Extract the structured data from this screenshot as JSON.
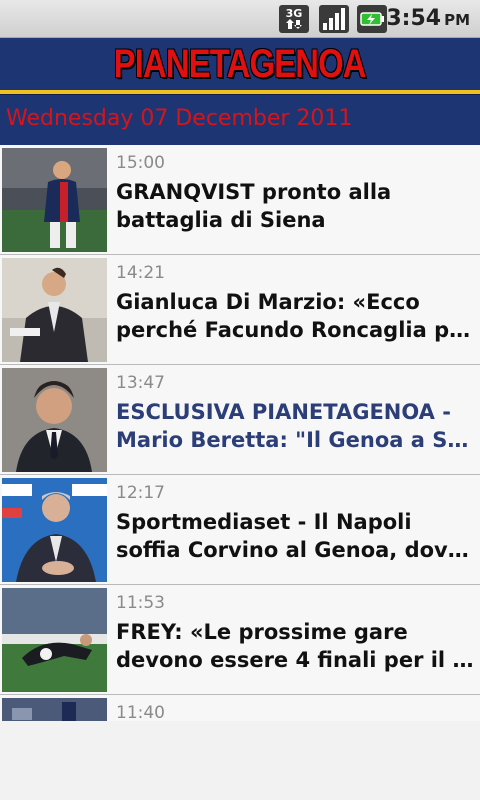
{
  "status_bar": {
    "network": "3G",
    "time": "3:54",
    "ampm": "PM"
  },
  "app": {
    "logo": "PIANETAGENOA",
    "date": "Wednesday 07 December 2011",
    "colors": {
      "header_bg": "#1e3574",
      "logo_red": "#e01010",
      "accent_gold": "#f0c020",
      "date_red": "#d7141a",
      "read_title": "#2c3e78"
    }
  },
  "news": [
    {
      "time": "15:00",
      "line1": "GRANQVIST pronto alla",
      "line2": "battaglia di Siena",
      "read": false
    },
    {
      "time": "14:21",
      "line1": "Gianluca Di Marzio: «Ecco",
      "line2": "perché Facundo Roncaglia po…",
      "read": false
    },
    {
      "time": "13:47",
      "line1": "ESCLUSIVA PIANETAGENOA -",
      "line2": "Mario Beretta: \"Il Genoa a Si…",
      "read": true
    },
    {
      "time": "12:17",
      "line1": "Sportmediaset - Il Napoli",
      "line2": "soffia Corvino al Genoa, dove…",
      "read": false
    },
    {
      "time": "11:53",
      "line1": "FREY: «Le prossime gare",
      "line2": "devono essere 4 finali per il …",
      "read": false
    },
    {
      "time": "11:40",
      "line1": "",
      "line2": "",
      "read": false
    }
  ]
}
